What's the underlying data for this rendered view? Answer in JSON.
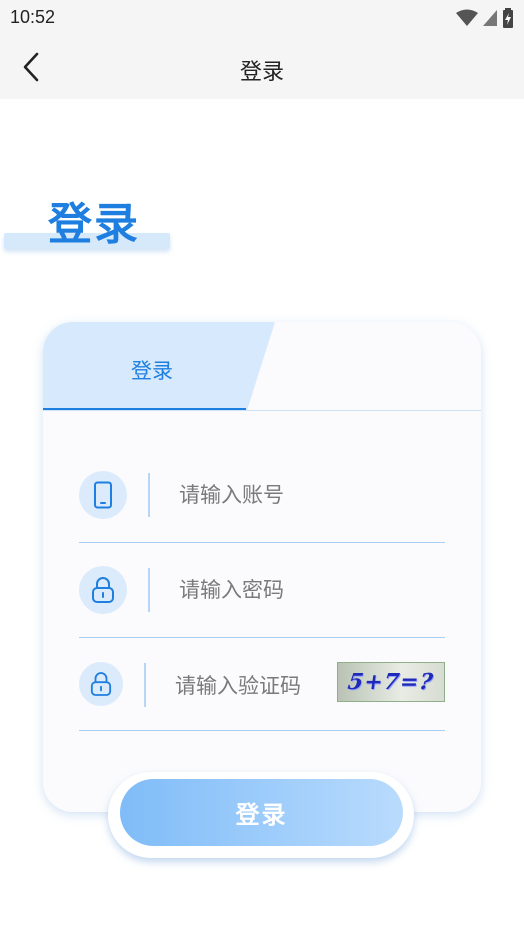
{
  "status_bar": {
    "time": "10:52",
    "icons": [
      "wifi-icon",
      "signal-icon",
      "battery-charging-icon"
    ]
  },
  "app_bar": {
    "back_icon": "chevron-left-icon",
    "title": "登录"
  },
  "hero": {
    "title": "登录"
  },
  "card": {
    "tabs": [
      {
        "label": "登录",
        "active": true
      }
    ],
    "fields": {
      "account": {
        "icon": "phone-icon",
        "placeholder": "请输入账号",
        "value": ""
      },
      "password": {
        "icon": "lock-icon",
        "placeholder": "请输入密码",
        "value": ""
      },
      "captcha": {
        "icon": "lock-icon",
        "placeholder": "请输入验证码",
        "value": "",
        "image_text": "5+7=?"
      }
    }
  },
  "login_button": {
    "label": "登录"
  },
  "colors": {
    "accent": "#1e7fe0",
    "tab_bg": "#d7e9fc",
    "icon_bg": "#dcebfb",
    "button_start": "#7fbcf8",
    "button_end": "#b9dbfd",
    "bar_bg": "#f5f5f5"
  }
}
